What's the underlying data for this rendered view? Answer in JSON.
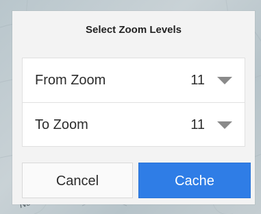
{
  "dialog": {
    "title": "Select Zoom Levels",
    "rows": [
      {
        "label": "From Zoom",
        "value": "11",
        "icon": "caret-down-icon"
      },
      {
        "label": "To Zoom",
        "value": "11",
        "icon": "caret-down-icon"
      }
    ],
    "cancel_label": "Cancel",
    "cache_label": "Cache"
  },
  "map": {
    "partial_label": "Nes"
  },
  "colors": {
    "accent": "#2f7de6",
    "dialog_bg": "#f3f3f3",
    "row_bg": "#ffffff",
    "caret": "#8a8a8a"
  }
}
